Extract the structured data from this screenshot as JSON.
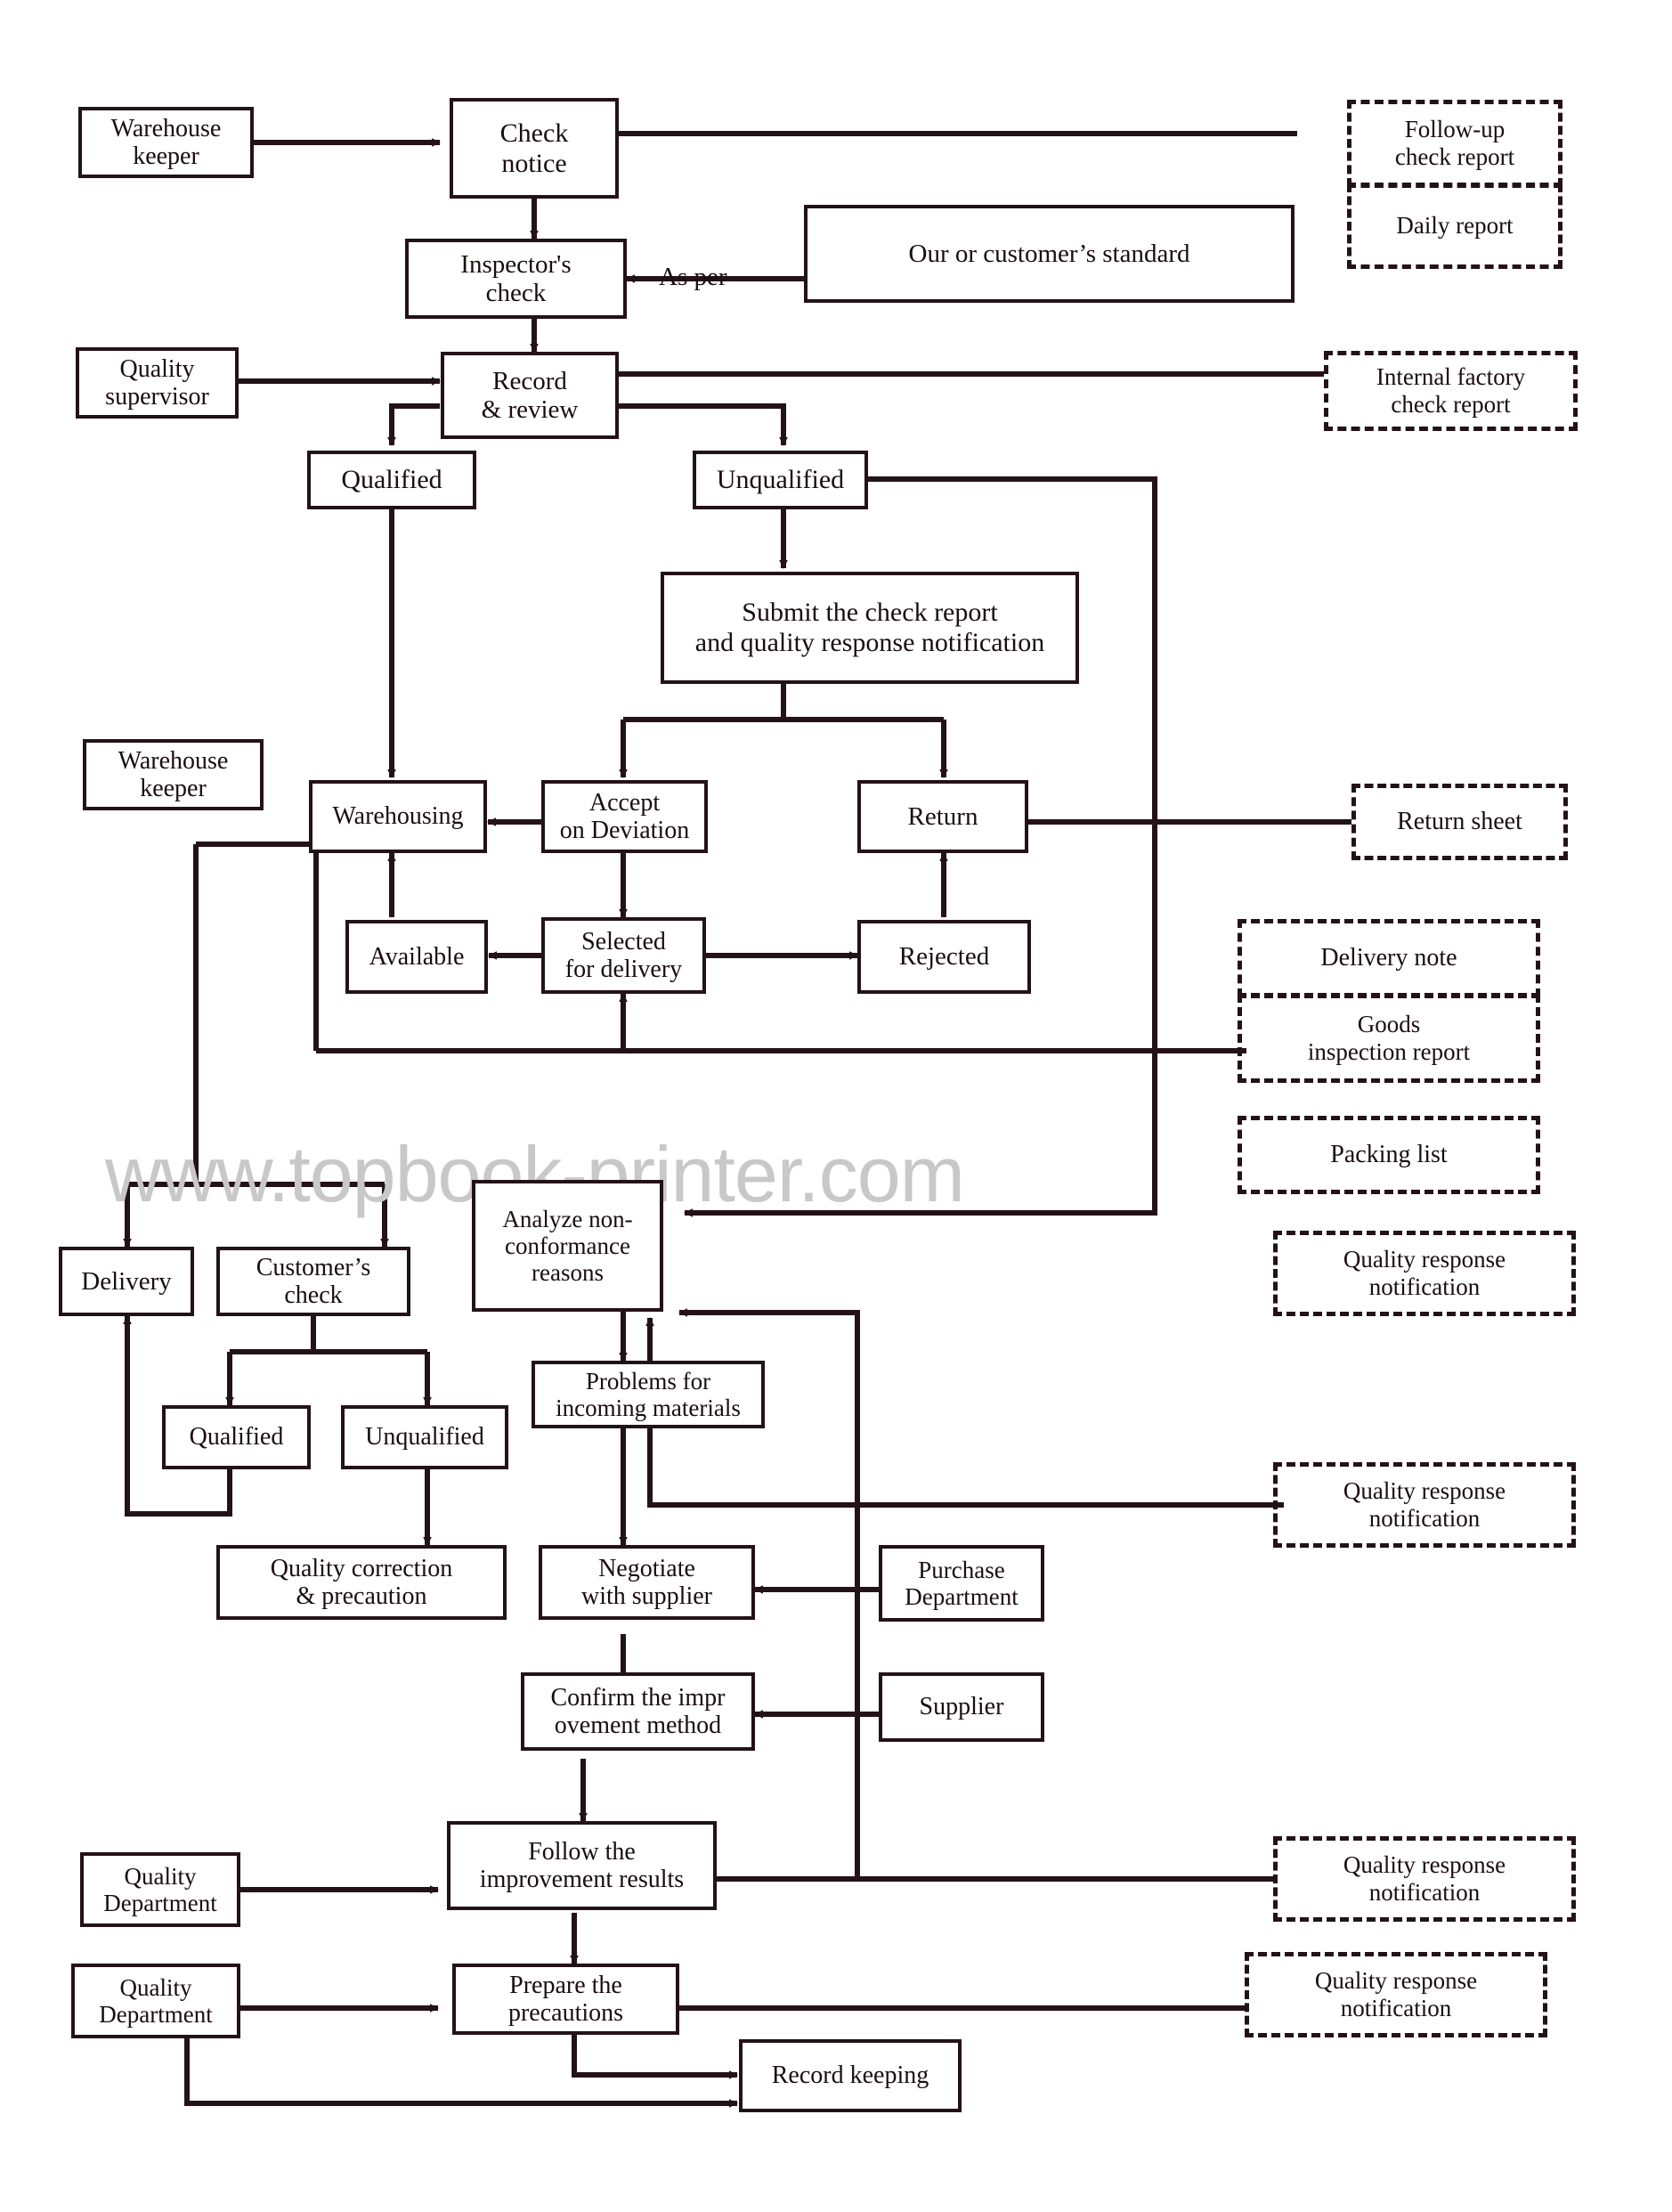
{
  "document": {
    "type": "process-flowchart",
    "subject": "Incoming goods quality inspection and improvement process",
    "watermark": "www.topbook-printer.com"
  },
  "nodes": {
    "warehouse_keeper_top": "Warehouse\nkeeper",
    "check_notice": "Check\nnotice",
    "inspectors_check": "Inspector's\ncheck",
    "standard": "Our or customer’s standard",
    "as_per": "As  per",
    "quality_supervisor": "Quality\nsupervisor",
    "record_review": "Record\n& review",
    "qualified_1": "Qualified",
    "unqualified_1": "Unqualified",
    "submit_report": "Submit the check report\nand quality response notification",
    "warehouse_keeper_mid": "Warehouse\nkeeper",
    "warehousing": "Warehousing",
    "accept_on_deviation": "Accept\non  Deviation",
    "return_box": "Return",
    "available": "Available",
    "selected_for_delivery": "Selected\nfor delivery",
    "rejected": "Rejected",
    "analyze_nonconformance": "Analyze non-\nconformance\nreasons",
    "delivery": "Delivery",
    "customers_check": "Customer’s\ncheck",
    "qualified_2": "Qualified",
    "unqualified_2": "Unqualified",
    "problems_incoming": "Problems for\nincoming materials",
    "quality_correction": "Quality correction\n& precaution",
    "negotiate_supplier": "Negotiate\nwith supplier",
    "purchase_department": "Purchase\nDepartment",
    "confirm_improvement": "Confirm the impr\novement method",
    "supplier": "Supplier",
    "follow_improvement": "Follow the\nimprovement results",
    "quality_department_1": "Quality\nDepartment",
    "prepare_precautions": "Prepare  the\nprecautions",
    "quality_department_2": "Quality\nDepartment",
    "record_keeping": "Record keeping"
  },
  "documents": {
    "followup_check_report": "Follow-up\ncheck report",
    "daily_report": "Daily report",
    "internal_factory_check_report": "Internal   factory\ncheck  report",
    "return_sheet": "Return sheet",
    "delivery_note": "Delivery  note",
    "goods_inspection_report": "Goods\ninspection report",
    "packing_list": "Packing   list",
    "quality_response_notification_1": "Quality response\nnotification",
    "quality_response_notification_2": "Quality response\nnotification",
    "quality_response_notification_3": "Quality response\nnotification",
    "quality_response_notification_4": "Quality response\nnotification"
  },
  "colors": {
    "line": "#231217",
    "box_fill": "#ffffff",
    "watermark": "#c8c8c8"
  }
}
